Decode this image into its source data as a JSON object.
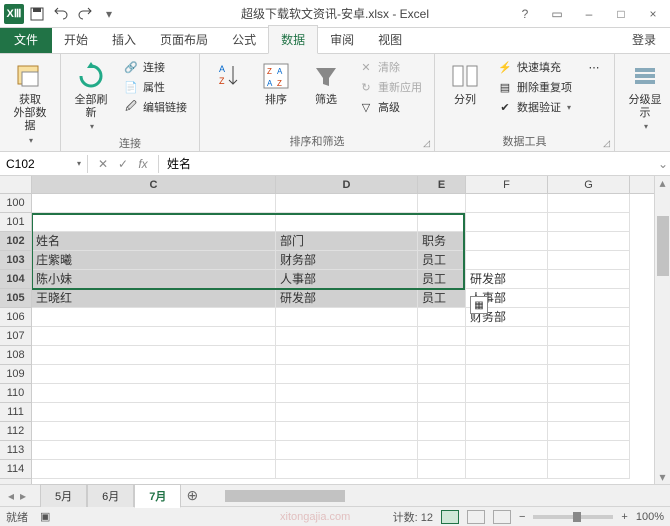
{
  "titlebar": {
    "app_icon": "XⅢ",
    "title": "超级下载软文资讯-安卓.xlsx - Excel",
    "help": "?",
    "ribbon_toggle": "▭",
    "minimize": "–",
    "restore": "□",
    "close": "×"
  },
  "ribbon_tabs": {
    "file": "文件",
    "tabs": [
      "开始",
      "插入",
      "页面布局",
      "公式",
      "数据",
      "审阅",
      "视图"
    ],
    "active_index": 4,
    "login": "登录"
  },
  "ribbon": {
    "group1": {
      "big1": "获取\n外部数据",
      "label": ""
    },
    "group2": {
      "big1": "全部刷新",
      "items": [
        "连接",
        "属性",
        "编辑链接"
      ],
      "label": "连接"
    },
    "group3": {
      "big_sort": "排序",
      "big_filter": "筛选",
      "items": [
        "清除",
        "重新应用",
        "高级"
      ],
      "label": "排序和筛选"
    },
    "group4": {
      "big1": "分列",
      "items": [
        "快速填充",
        "删除重复项",
        "数据验证"
      ],
      "label": "数据工具"
    },
    "group5": {
      "big1": "分级显示",
      "label": ""
    }
  },
  "formula_bar": {
    "namebox": "C102",
    "fx": "fx",
    "formula": "姓名"
  },
  "sheet": {
    "cols": [
      "C",
      "D",
      "E",
      "F",
      "G"
    ],
    "selected_cols": [
      "C",
      "D",
      "E"
    ],
    "row_start": 100,
    "row_end": 114,
    "selected_rows": [
      102,
      103,
      104,
      105
    ],
    "rows": {
      "102": {
        "C": "姓名",
        "D": "部门",
        "E": "职务"
      },
      "103": {
        "C": "庄紫曦",
        "D": "财务部",
        "E": "员工"
      },
      "104": {
        "C": "陈小妹",
        "D": "人事部",
        "E": "员工",
        "F": "研发部"
      },
      "105": {
        "C": "王晓红",
        "D": "研发部",
        "E": "员工",
        "F": "人事部"
      },
      "106": {
        "F": "财务部"
      }
    }
  },
  "sheet_tabs": {
    "tabs": [
      "5月",
      "6月",
      "7月"
    ],
    "active_index": 2
  },
  "statusbar": {
    "mode": "就绪",
    "count_label": "计数:",
    "count": "12",
    "zoom": "100%",
    "watermark": "xitongajia.com"
  }
}
